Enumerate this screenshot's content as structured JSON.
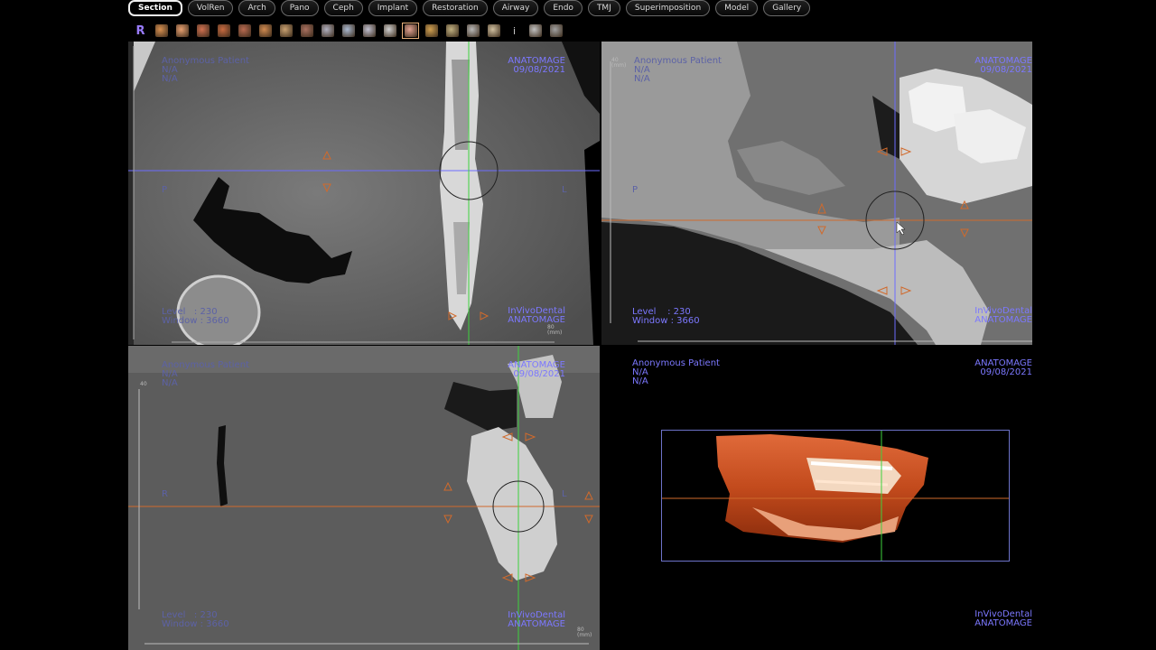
{
  "tabs": [
    {
      "label": "Section",
      "active": true
    },
    {
      "label": "VolRen"
    },
    {
      "label": "Arch"
    },
    {
      "label": "Pano"
    },
    {
      "label": "Ceph"
    },
    {
      "label": "Implant"
    },
    {
      "label": "Restoration"
    },
    {
      "label": "Airway"
    },
    {
      "label": "Endo"
    },
    {
      "label": "TMJ"
    },
    {
      "label": "Superimposition"
    },
    {
      "label": "Model"
    },
    {
      "label": "Gallery"
    }
  ],
  "toolbar": {
    "reset_label": "R",
    "info_label": "i",
    "icons": [
      "hand-icon",
      "face-icon",
      "face-tilt-icon",
      "bone-icon",
      "skull-icon",
      "teeth-icon",
      "house-icon",
      "hand-grab-icon",
      "ruler-icon",
      "measure-icon",
      "airway-icon",
      "arch-icon",
      "portrait-icon",
      "pencil-icon",
      "brush-icon",
      "annotate-icon",
      "text-tool-icon",
      "layout-icon",
      "rotate-icon"
    ]
  },
  "colors": {
    "crosshair_orange": "#d06a2c",
    "crosshair_green": "#3ed23e",
    "crosshair_blue": "#6c6cff",
    "overlay_text": "#7c78ff",
    "render_orange": "#c85020"
  },
  "views": {
    "axial": {
      "patient": "Anonymous Patient",
      "line2": "N/A",
      "line3": "N/A",
      "brand": "ANATOMAGE",
      "date": "09/08/2021",
      "left_orient": "P",
      "right_orient": "L",
      "level": "Level   : 230",
      "window": "Window : 3660",
      "footer1": "InVivoDental",
      "footer2": "ANATOMAGE",
      "scale_mm": "(mm)",
      "scale_max": "80"
    },
    "sagittal": {
      "patient": "Anonymous Patient",
      "line2": "N/A",
      "line3": "N/A",
      "brand": "ANATOMAGE",
      "date": "09/08/2021",
      "left_orient": "P",
      "level": "Level    : 230",
      "window": "Window : 3660",
      "footer1": "InVivoDental",
      "footer2": "ANATOMAGE",
      "scale_mm": "(mm)",
      "scale_max": "40"
    },
    "coronal": {
      "patient": "Anonymous Patient",
      "line2": "N/A",
      "line3": "N/A",
      "brand": "ANATOMAGE",
      "date": "09/08/2021",
      "left_orient": "R",
      "right_orient": "L",
      "level": "Level   : 230",
      "window": "Window : 3660",
      "footer1": "InVivoDental",
      "footer2": "ANATOMAGE",
      "scale_mm": "(mm)",
      "scale_max": "80",
      "scale_top": "40"
    },
    "volume": {
      "patient": "Anonymous Patient",
      "line2": "N/A",
      "line3": "N/A",
      "brand": "ANATOMAGE",
      "date": "09/08/2021",
      "footer1": "InVivoDental",
      "footer2": "ANATOMAGE"
    }
  }
}
